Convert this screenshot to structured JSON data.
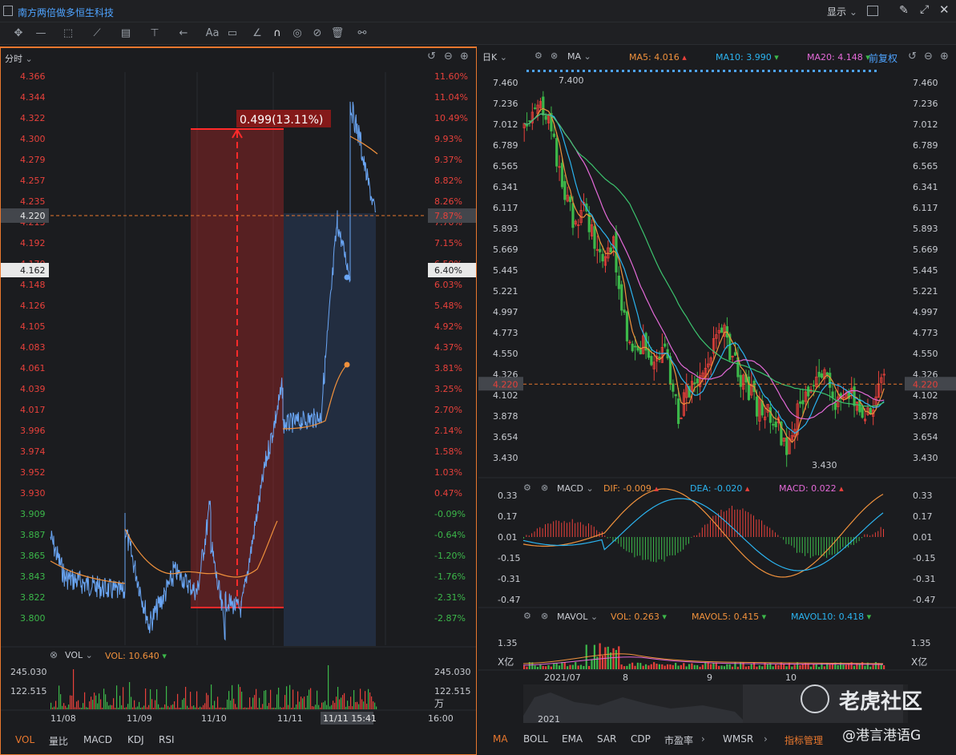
{
  "window": {
    "title": "南方两倍做多恒生科技",
    "display_label": "显示"
  },
  "intraday": {
    "tab": "分时",
    "price_ticks": [
      "4.366",
      "4.344",
      "4.322",
      "4.300",
      "4.279",
      "4.257",
      "4.235",
      "4.213",
      "4.192",
      "4.170",
      "4.148",
      "4.126",
      "4.105",
      "4.083",
      "4.061",
      "4.039",
      "4.017",
      "3.996",
      "3.974",
      "3.952",
      "3.930",
      "3.909",
      "3.887",
      "3.865",
      "3.843",
      "3.822",
      "3.800"
    ],
    "pct_ticks": [
      "11.60%",
      "11.04%",
      "10.49%",
      "9.93%",
      "9.37%",
      "8.82%",
      "8.26%",
      "7.70%",
      "7.15%",
      "6.59%",
      "6.03%",
      "5.48%",
      "4.92%",
      "4.37%",
      "3.81%",
      "3.25%",
      "2.70%",
      "2.14%",
      "1.58%",
      "1.03%",
      "0.47%",
      "-0.09%",
      "-0.64%",
      "-1.20%",
      "-1.76%",
      "-2.31%",
      "-2.87%"
    ],
    "current_price_tag": "4.220",
    "current_pct_tag": "7.87%",
    "cursor_price_tag": "4.162",
    "cursor_pct_tag": "6.40%",
    "measure_label": "0.499(13.11%)",
    "vol_label": "VOL",
    "vol_value": "VOL: 10.640",
    "vol_ticks": [
      "245.030",
      "122.515"
    ],
    "vol_unit": "万",
    "dates": [
      "11/08",
      "11/09",
      "11/10",
      "11/11",
      "16:00"
    ],
    "date_cursor": "11/11 15:41",
    "bottom_tabs": [
      "VOL",
      "量比",
      "MACD",
      "KDJ",
      "RSI"
    ],
    "colors": {
      "price_line": "#6aa6f5",
      "avg_line": "#f0913c",
      "up": "#e8413b",
      "down": "#3cb84a"
    }
  },
  "daily": {
    "tab": "日K",
    "ma_label": "MA",
    "ma5": "MA5: 4.016",
    "ma10": "MA10: 3.990",
    "ma20": "MA20: 4.148",
    "adjust": "前复权",
    "price_ticks": [
      "7.460",
      "7.236",
      "7.012",
      "6.789",
      "6.565",
      "6.341",
      "6.117",
      "5.893",
      "5.669",
      "5.445",
      "5.221",
      "4.997",
      "4.773",
      "4.550",
      "4.326",
      "4.102",
      "3.878",
      "3.654",
      "3.430"
    ],
    "current_price_tag": "4.220",
    "high_label": "7.400",
    "low_label": "3.430",
    "macd": {
      "label": "MACD",
      "dif": "DIF: -0.009",
      "dea": "DEA: -0.020",
      "macd": "MACD: 0.022",
      "ticks": [
        "0.33",
        "0.17",
        "0.01",
        "-0.15",
        "-0.31",
        "-0.47"
      ]
    },
    "mavol": {
      "label": "MAVOL",
      "vol": "VOL: 0.263",
      "mavol5": "MAVOL5: 0.415",
      "mavol10": "MAVOL10: 0.418",
      "ticks": [
        "1.35",
        "X亿"
      ]
    },
    "months": [
      "2021/07",
      "8",
      "9",
      "10"
    ],
    "overview_year": "2021",
    "bottom_tabs": [
      "MA",
      "BOLL",
      "EMA",
      "SAR",
      "CDP",
      "市盈率",
      "WMSR",
      "指标管理"
    ],
    "watermark": "老虎社区",
    "author": "@港言港语G",
    "colors": {
      "ma5": "#f0913c",
      "ma10": "#2bb4f0",
      "ma20": "#e46ad8",
      "ma60": "#3cc46e"
    }
  }
}
